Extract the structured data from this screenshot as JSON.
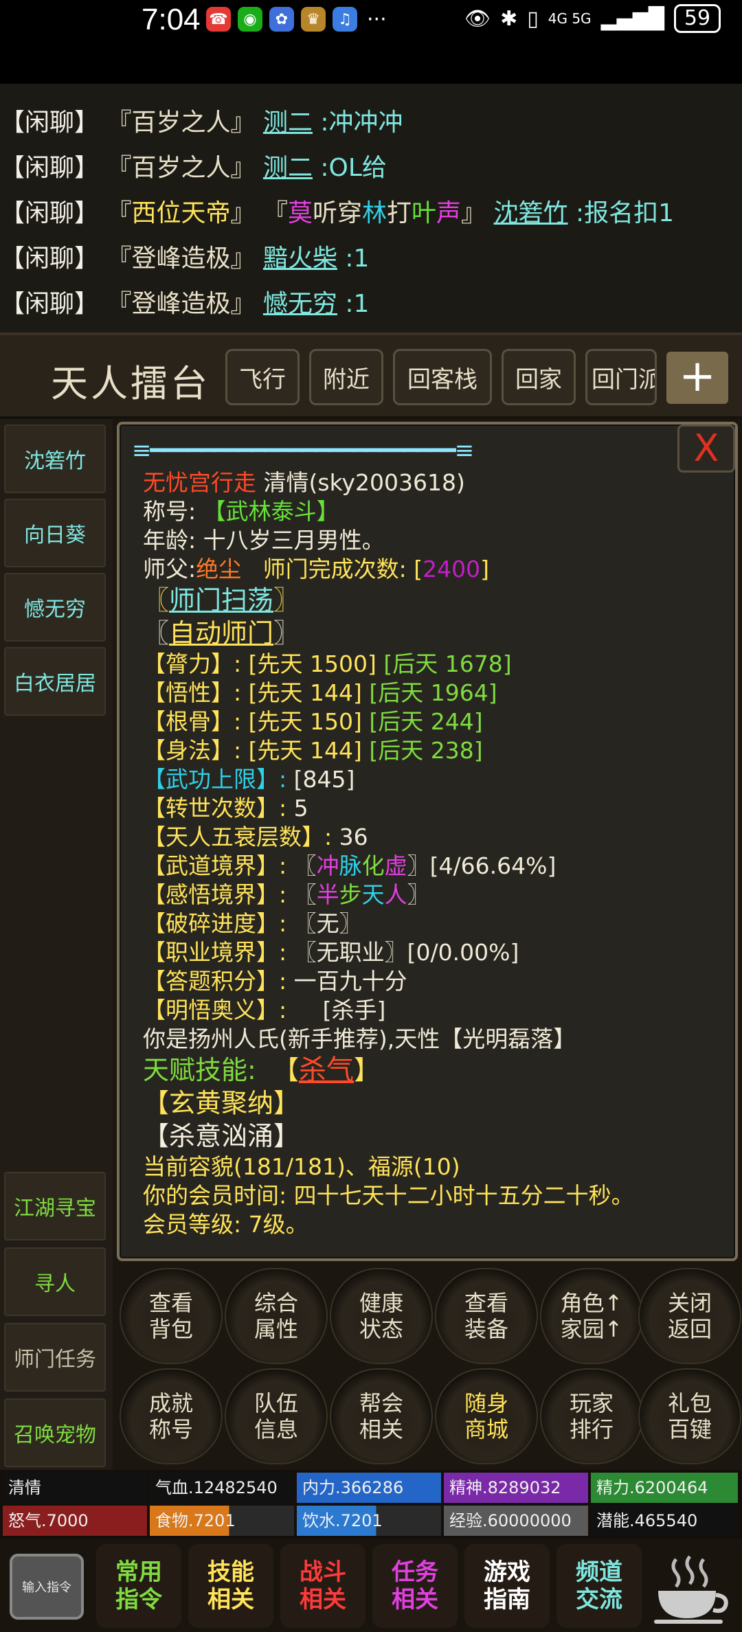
{
  "statusbar": {
    "time": "7:04",
    "network": "4G 5G",
    "battery": "59",
    "icons": [
      "phone-icon",
      "wechat-icon",
      "browser-icon",
      "game-icon",
      "music-icon",
      "eye-icon",
      "bluetooth-icon",
      "vibrate-icon",
      "signal-icon",
      "signal-icon"
    ]
  },
  "chat": {
    "tag": "【闲聊】",
    "lines": [
      {
        "parts": [
          "『百岁之人』",
          "测二",
          ":冲冲冲"
        ]
      },
      {
        "parts": [
          "『百岁之人』",
          "测二",
          ":OL给"
        ]
      },
      {
        "parts": [
          "『",
          "西位天帝",
          "』 『",
          "莫",
          "听",
          "穿",
          "林",
          "打",
          "叶",
          "声",
          "』",
          "沈箬竹",
          ":报名扣1"
        ]
      },
      {
        "parts": [
          "『登峰造极』",
          "黯火柴",
          ":1"
        ]
      },
      {
        "parts": [
          "『登峰造极』",
          "憾无穷",
          ":1"
        ]
      }
    ]
  },
  "nav": {
    "title": "天人擂台",
    "buttons": [
      "飞行",
      "附近",
      "回客栈",
      "回家",
      "回门派"
    ],
    "plus": "+"
  },
  "left_nav": {
    "top": [
      "沈箬竹",
      "向日葵",
      "憾无穷",
      "白衣居居"
    ],
    "bottom": [
      "江湖寻宝",
      "寻人",
      "师门任务",
      "召唤宠物"
    ]
  },
  "panel": {
    "separator": "≡━━━━━━━━━━━━━━━━━━━━━━━━≡",
    "close": "X",
    "sect": "无忧宫行走",
    "name": "清情(sky2003618)",
    "title_label": "称号:",
    "title_value": "【武林泰斗】",
    "age": "年龄: 十八岁三月男性。",
    "master_label": "师父:",
    "master_value": "绝尘",
    "sect_count_label": "师门完成次数: [",
    "sect_count_value": "2400",
    "sect_count_end": "]",
    "link1": "师门扫荡",
    "link2": "自动师门",
    "stats": [
      {
        "label": "【膂力】",
        "base": "[先天 1500]",
        "post": "[后天 1678]"
      },
      {
        "label": "【悟性】",
        "base": "[先天 144]",
        "post": "[后天 1964]"
      },
      {
        "label": "【根骨】",
        "base": "[先天 150]",
        "post": "[后天 244]"
      },
      {
        "label": "【身法】",
        "base": "[先天 144]",
        "post": "[后天 238]"
      }
    ],
    "wugong_label": "【武功上限】:",
    "wugong_value": "[845]",
    "rebirth_label": "【转世次数】:",
    "rebirth_value": "5",
    "decay_label": "【天人五衰层数】:",
    "decay_value": "36",
    "wudao_label": "【武道境界】:",
    "wudao_chars": [
      "冲",
      "脉",
      "化",
      "虚"
    ],
    "wudao_progress": "[4/66.64%]",
    "ganwu_label": "【感悟境界】:",
    "ganwu_chars": [
      "半",
      "步",
      "天",
      "人"
    ],
    "posui_label": "【破碎进度】:",
    "posui_value": "〖无〗",
    "zhiye_label": "【职业境界】:",
    "zhiye_value": "〖无职业〗[0/0.00%]",
    "dati_label": "【答题积分】:",
    "dati_value": "一百九十分",
    "mingwu_label": "【明悟奥义】:",
    "mingwu_value": "[杀手]",
    "origin": "你是扬州人氏(新手推荐),天性【光明磊落】",
    "talent_label": "天赋技能:",
    "talent_value": "杀气",
    "skill1": "【玄黄聚纳】",
    "skill2": "【杀意汹涌】",
    "appearance": "当前容貌(181/181)、福源(10)",
    "vip_time": "你的会员时间: 四十七天十二小时十五分二十秒。",
    "vip_level": "会员等级: 7级。"
  },
  "grid": [
    [
      "查看",
      "背包"
    ],
    [
      "综合",
      "属性"
    ],
    [
      "健康",
      "状态"
    ],
    [
      "查看",
      "装备"
    ],
    [
      "角色↑",
      "家园↑"
    ],
    [
      "关闭",
      "返回"
    ],
    [
      "成就",
      "称号"
    ],
    [
      "队伍",
      "信息"
    ],
    [
      "帮会",
      "相关"
    ],
    [
      "随身",
      "商城"
    ],
    [
      "玩家",
      "排行"
    ],
    [
      "礼包",
      "百键"
    ]
  ],
  "bars": {
    "name": "清情",
    "hp": "气血.12482540",
    "neili": "内力.366286",
    "jingshen": "精神.8289032",
    "jingli": "精力.6200464",
    "nuqi": "怒气.7000",
    "food": "食物.7201",
    "water": "饮水.7201",
    "exp": "经验.60000000",
    "potential": "潜能.465540",
    "fills": {
      "hp": 1.0,
      "neili": 1.0,
      "jingshen": 1.0,
      "jingli": 1.0,
      "nuqi": 1.0,
      "food": 0.55,
      "water": 0.55,
      "exp": 1.0
    }
  },
  "bottom": {
    "input": "输入指令",
    "buttons": [
      [
        "常用",
        "指令"
      ],
      [
        "技能",
        "相关"
      ],
      [
        "战斗",
        "相关"
      ],
      [
        "任务",
        "相关"
      ],
      [
        "游戏",
        "指南"
      ],
      [
        "频道",
        "交流"
      ]
    ]
  }
}
